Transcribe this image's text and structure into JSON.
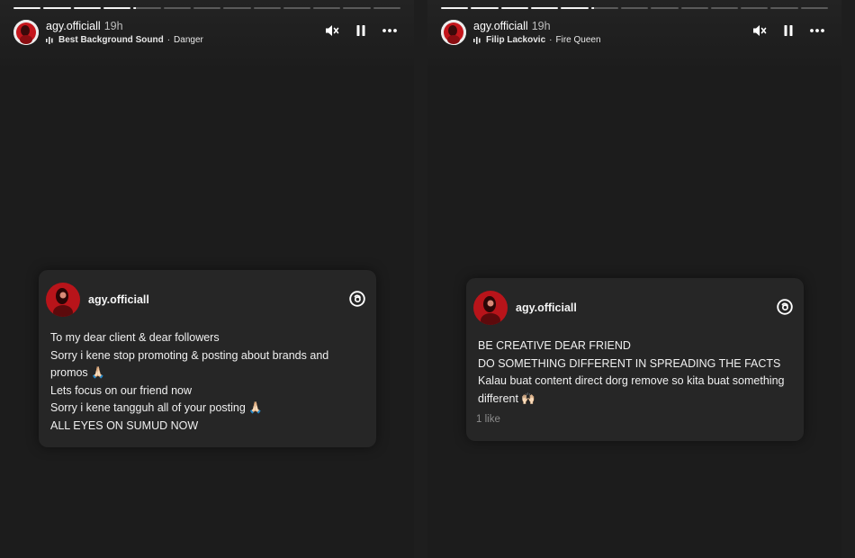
{
  "stories": [
    {
      "user": "agy.officiall",
      "time": "19h",
      "music_title": "Best Background Sound",
      "music_sep": " · ",
      "music_artist": "Danger",
      "progress": {
        "segments": 13,
        "completed": 4,
        "current_fraction": 0.1
      },
      "card": {
        "user": "agy.officiall",
        "lines": [
          "To my dear client & dear followers",
          "Sorry i kene stop promoting & posting about brands and promos 🙏🏻",
          "Lets focus on our friend now",
          "Sorry i kene tangguh all of your posting 🙏🏻",
          "ALL EYES ON SUMUD NOW"
        ]
      }
    },
    {
      "user": "agy.officiall",
      "time": "19h",
      "music_title": "Filip Lackovic",
      "music_sep": " · ",
      "music_artist": "Fire Queen",
      "progress": {
        "segments": 13,
        "completed": 5,
        "current_fraction": 0.05
      },
      "card": {
        "user": "agy.officiall",
        "lines": [
          "BE CREATIVE DEAR FRIEND",
          "DO SOMETHING DIFFERENT IN SPREADING THE FACTS",
          "Kalau buat content direct dorg remove so kita buat something different 🙌🏻"
        ],
        "likes": "1 like"
      }
    }
  ],
  "icons": {
    "mute": "speaker-muted-icon",
    "pause": "pause-icon",
    "more": "more-dots-icon",
    "threads": "threads-logo-icon",
    "music": "audio-eq-icon"
  },
  "colors": {
    "background": "#1c1c1c",
    "card": "#262626",
    "progress_done": "#f2f2f2",
    "progress_pending": "#5a5a5a",
    "avatar_red": "#c4161c"
  }
}
